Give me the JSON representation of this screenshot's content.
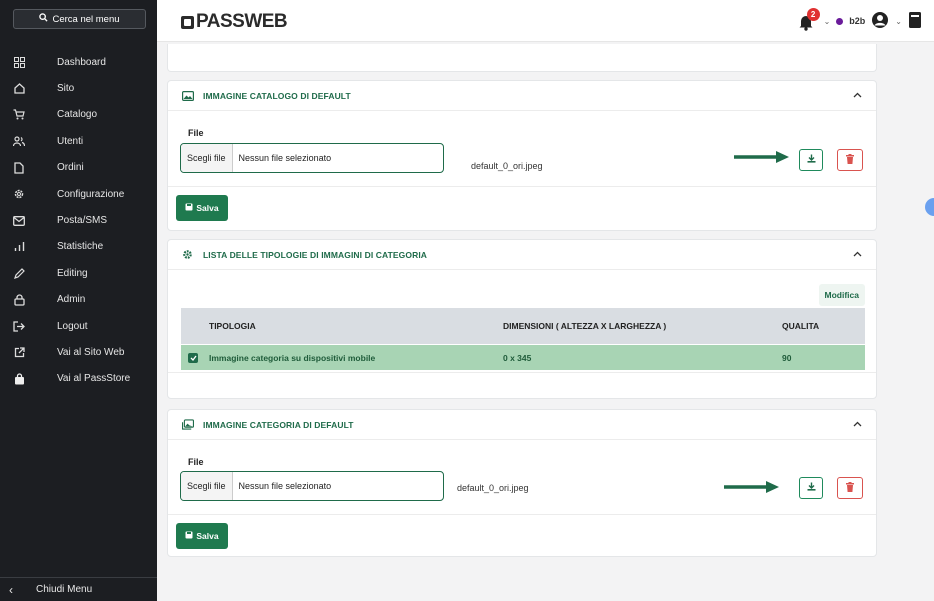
{
  "sidebar": {
    "search_label": "Cerca nel menu",
    "items": [
      {
        "label": "Dashboard",
        "icon": "dashboard-icon"
      },
      {
        "label": "Sito",
        "icon": "home-icon"
      },
      {
        "label": "Catalogo",
        "icon": "cart-icon"
      },
      {
        "label": "Utenti",
        "icon": "users-icon"
      },
      {
        "label": "Ordini",
        "icon": "document-icon"
      },
      {
        "label": "Configurazione",
        "icon": "gear-icon"
      },
      {
        "label": "Posta/SMS",
        "icon": "mail-icon"
      },
      {
        "label": "Statistiche",
        "icon": "bar-chart-icon"
      },
      {
        "label": "Editing",
        "icon": "pencil-icon"
      },
      {
        "label": "Admin",
        "icon": "lock-icon"
      },
      {
        "label": "Logout",
        "icon": "logout-icon"
      },
      {
        "label": "Vai al Sito Web",
        "icon": "external-link-icon"
      },
      {
        "label": "Vai al PassStore",
        "icon": "shopping-bag-icon"
      }
    ],
    "footer_label": "Chiudi Menu"
  },
  "header": {
    "logo": "PASSWEB",
    "notification_count": "2",
    "account_label": "b2b"
  },
  "card_catalog_image": {
    "title": "IMMAGINE CATALOGO DI DEFAULT",
    "file_label": "File",
    "choose_label": "Scegli file",
    "no_file_label": "Nessun file selezionato",
    "filename": "default_0_ori.jpeg",
    "save_label": "Salva"
  },
  "card_category_types": {
    "title": "LISTA DELLE TIPOLOGIE DI IMMAGINI DI CATEGORIA",
    "edit_label": "Modifica",
    "columns": [
      "TIPOLOGIA",
      "DIMENSIONI ( ALTEZZA X LARGHEZZA )",
      "QUALITA"
    ],
    "rows": [
      {
        "tipologia": "Immagine categoria su dispositivi mobile",
        "dimensioni": "0 x 345",
        "qualita": "90"
      }
    ]
  },
  "card_category_image": {
    "title": "IMMAGINE CATEGORIA DI DEFAULT",
    "file_label": "File",
    "choose_label": "Scegli file",
    "no_file_label": "Nessun file selezionato",
    "filename": "default_0_ori.jpeg",
    "save_label": "Salva"
  },
  "colors": {
    "accent": "#1f6b4a",
    "sidebar_bg": "#1c1e22",
    "delete": "#d9534f",
    "row_selected": "#a8d4b4"
  }
}
